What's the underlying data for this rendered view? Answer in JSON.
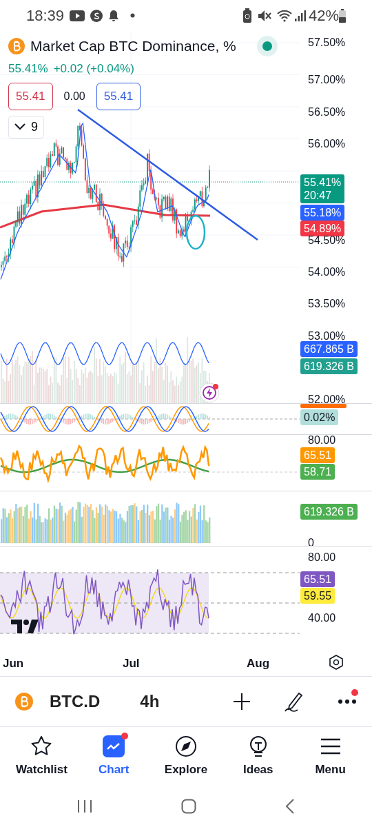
{
  "status_bar": {
    "time": "18:39",
    "battery": "42%"
  },
  "legend": {
    "title": "Market Cap BTC Dominance, %",
    "last": "55.41%",
    "change": "+0.02 (+0.04%)",
    "bid": "55.41",
    "spread": "0.00",
    "ask": "55.41",
    "indicators": "9"
  },
  "panes": [
    {
      "kind": "price",
      "axis": [
        {
          "kind": "tick",
          "label": "57.50%"
        },
        {
          "kind": "tick",
          "label": "57.00%"
        },
        {
          "kind": "tick",
          "label": "56.50%"
        },
        {
          "kind": "tick",
          "label": "56.00%"
        },
        {
          "kind": "tag",
          "label": "55.41%",
          "sublabel": "20:47",
          "color": "#089981"
        },
        {
          "kind": "tag",
          "label": "55.18%",
          "color": "#2962ff"
        },
        {
          "kind": "tag",
          "label": "54.89%",
          "color": "#f23645"
        },
        {
          "kind": "tick",
          "label": "54.50%"
        },
        {
          "kind": "tick",
          "label": "54.00%"
        },
        {
          "kind": "tick",
          "label": "53.50%"
        },
        {
          "kind": "tick",
          "label": "53.00%"
        },
        {
          "kind": "tag",
          "label": "667.865 B",
          "color": "#2962ff"
        },
        {
          "kind": "tag",
          "label": "619.326 B",
          "color": "#22a08f"
        },
        {
          "kind": "tick",
          "label": "52.00%"
        }
      ]
    },
    {
      "kind": "macd",
      "axis": [
        {
          "kind": "bar",
          "color": "#ff6d00"
        },
        {
          "kind": "tag",
          "label": "0.02%",
          "color": "#b2dfdb"
        }
      ]
    },
    {
      "kind": "stoch",
      "axis": [
        {
          "kind": "tick",
          "label": "80.00"
        },
        {
          "kind": "tag",
          "label": "65.51",
          "color": "#ff9800"
        },
        {
          "kind": "tag",
          "label": "58.71",
          "color": "#4caf50"
        }
      ]
    },
    {
      "kind": "volume",
      "axis": [
        {
          "kind": "tag",
          "label": "619.326 B",
          "color": "#4caf50"
        },
        {
          "kind": "tick",
          "label": "0"
        }
      ]
    },
    {
      "kind": "rsi",
      "axis": [
        {
          "kind": "tick",
          "label": "80.00"
        },
        {
          "kind": "tag",
          "label": "65.51",
          "color": "#7e57c2"
        },
        {
          "kind": "tag",
          "label": "59.55",
          "color": "#ffeb3b"
        },
        {
          "kind": "tick",
          "label": "40.00"
        }
      ]
    }
  ],
  "x_axis": [
    "Jun",
    "Jul",
    "Aug"
  ],
  "symbol": {
    "ticker": "BTC.D",
    "interval": "4h",
    "more_badge": true
  },
  "nav": [
    {
      "label": "Watchlist",
      "selected": false,
      "badge": false
    },
    {
      "label": "Chart",
      "selected": true,
      "badge": true
    },
    {
      "label": "Explore",
      "selected": false,
      "badge": false
    },
    {
      "label": "Ideas",
      "selected": false,
      "badge": false
    },
    {
      "label": "Menu",
      "selected": false,
      "badge": false
    }
  ]
}
